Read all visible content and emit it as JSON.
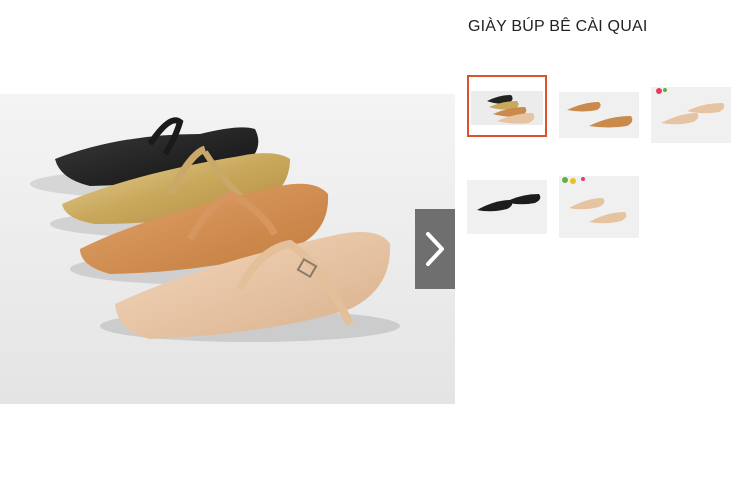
{
  "product": {
    "title": "GIÀY BÚP BÊ CÀI QUAI"
  },
  "gallery": {
    "main_image": "four-pointed-toe-mary-jane-flats-black-gold-tan-nude",
    "next_icon": "chevron-right-icon",
    "selected_index": 0,
    "thumbnails": [
      {
        "image": "four-flats-group"
      },
      {
        "image": "tan-flats-pair"
      },
      {
        "image": "nude-flats-pair"
      },
      {
        "image": "black-flats-pair"
      },
      {
        "image": "nude-flats-pair-flowers"
      }
    ],
    "colors": {
      "accent": "#d9542b",
      "nav_button": "#6f6f6f"
    }
  }
}
